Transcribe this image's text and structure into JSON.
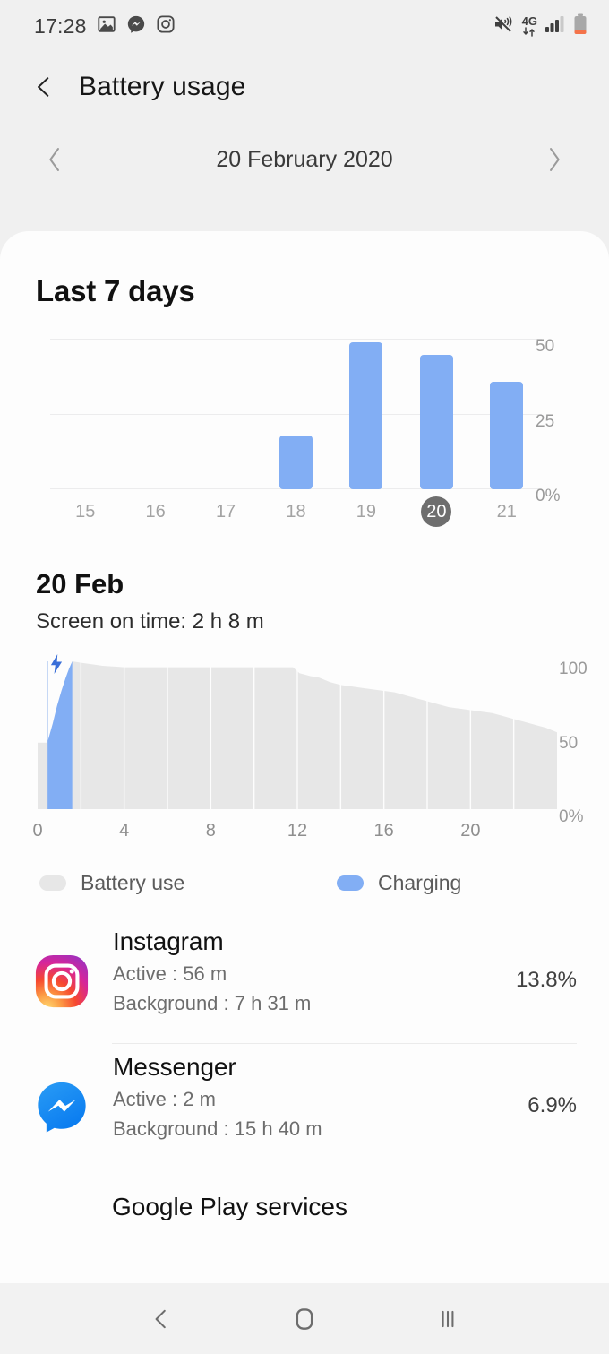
{
  "status_bar": {
    "time": "17:28",
    "left_icons": [
      "gallery-icon",
      "messenger-icon",
      "instagram-icon"
    ],
    "network_label": "4G",
    "right_icons": [
      "mute-vibrate-icon",
      "mobile-data-icon",
      "signal-bars-icon",
      "battery-icon"
    ]
  },
  "header": {
    "back_icon": "back-chevron-icon",
    "title": "Battery usage"
  },
  "date_nav": {
    "prev_icon": "chevron-left-icon",
    "date": "20 February 2020",
    "next_icon": "chevron-right-icon"
  },
  "week_section": {
    "title": "Last 7 days"
  },
  "day_section": {
    "title": "20 Feb",
    "screen_on_time": "Screen on time: 2 h 8 m"
  },
  "legend": {
    "battery_use": "Battery use",
    "charging": "Charging",
    "battery_use_color": "#e7e7e7",
    "charging_color": "#82aef4"
  },
  "apps": [
    {
      "name": "Instagram",
      "active": "Active : 56 m",
      "background": "Background : 7 h 31 m",
      "percent": "13.8%",
      "icon": "instagram-icon"
    },
    {
      "name": "Messenger",
      "active": "Active : 2 m",
      "background": "Background : 15 h 40 m",
      "percent": "6.9%",
      "icon": "messenger-icon"
    }
  ],
  "cut_off_app": "Google Play services",
  "nav_bar": {
    "back": "back-icon",
    "home": "home-icon",
    "recents": "recents-icon"
  },
  "colors": {
    "accent_blue": "#82aef4",
    "area_gray": "#e7e7e7",
    "selected_day": "#6e6e6e",
    "card_bg": "#fdfdfd",
    "page_bg": "#f0f0f0"
  },
  "chart_data": [
    {
      "type": "bar",
      "title": "Last 7 days",
      "categories": [
        "15",
        "16",
        "17",
        "18",
        "19",
        "20",
        "21"
      ],
      "values": [
        0,
        0,
        0,
        18,
        49,
        45,
        36
      ],
      "selected_category": "20",
      "ylabel": "",
      "xlabel": "",
      "ylim": [
        0,
        50
      ],
      "ytick_labels": [
        "0%",
        "25",
        "50"
      ],
      "ytick_values": [
        0,
        25,
        50
      ],
      "grid": true,
      "legend": false,
      "bar_color": "#82aef4"
    },
    {
      "type": "area",
      "title": "20 Feb",
      "xlabel": "",
      "ylabel": "",
      "xlim": [
        0,
        24
      ],
      "ylim": [
        0,
        100
      ],
      "xtick_labels": [
        "0",
        "4",
        "8",
        "12",
        "16",
        "20"
      ],
      "xtick_values": [
        0,
        4,
        8,
        12,
        16,
        20
      ],
      "ytick_labels": [
        "0%",
        "50",
        "100"
      ],
      "ytick_values": [
        0,
        50,
        100
      ],
      "grid": true,
      "annotation": "charging-bolt-icon",
      "charge_start_hour": 0.45,
      "charge_end_hour": 1.6,
      "series": [
        {
          "name": "Charging",
          "color": "#82aef4",
          "x": [
            0.45,
            0.7,
            0.9,
            1.1,
            1.3,
            1.45,
            1.6
          ],
          "values": [
            45,
            58,
            70,
            80,
            89,
            95,
            100
          ]
        },
        {
          "name": "Battery use",
          "color": "#e7e7e7",
          "x": [
            0,
            0.45,
            1.6,
            2,
            2.5,
            3,
            4,
            5,
            6,
            7,
            8,
            9,
            10,
            11,
            11.8,
            12.1,
            12.6,
            13,
            13.5,
            14,
            14.5,
            15,
            15.5,
            16,
            16.5,
            17,
            17.5,
            18,
            18.5,
            19,
            19.5,
            20,
            20.5,
            21,
            21.5,
            22,
            22.5,
            23,
            23.5,
            24
          ],
          "values": [
            45,
            45,
            100,
            99,
            98,
            97,
            96,
            96,
            96,
            96,
            96,
            96,
            96,
            96,
            96,
            92,
            90,
            89,
            86,
            84,
            83,
            82,
            81,
            80,
            79,
            77,
            75,
            73,
            71,
            69,
            68,
            67,
            66,
            65,
            63,
            61,
            59,
            57,
            55,
            52
          ]
        }
      ]
    }
  ]
}
